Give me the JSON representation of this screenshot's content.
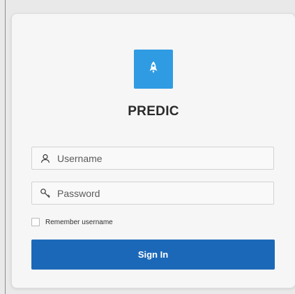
{
  "app": {
    "title": "PREDIC",
    "logo_icon": "rocket-icon",
    "logo_color": "#2f9be2"
  },
  "login_form": {
    "username": {
      "placeholder": "Username",
      "value": "",
      "icon": "user-icon"
    },
    "password": {
      "placeholder": "Password",
      "value": "",
      "icon": "key-icon"
    },
    "remember": {
      "label": "Remember username",
      "checked": false
    },
    "submit_label": "Sign In",
    "submit_color": "#1c68b8"
  }
}
